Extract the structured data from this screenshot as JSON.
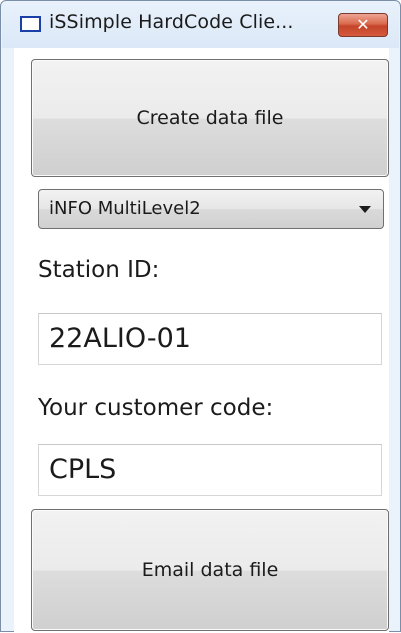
{
  "window": {
    "title": "iSSimple HardCode Clie...",
    "close_label": "✕"
  },
  "buttons": {
    "create_label": "Create data file",
    "email_label": "Email data file"
  },
  "dropdown": {
    "selected": "iNFO MultiLevel2"
  },
  "station": {
    "label": "Station ID:",
    "value": "22ALIO-01"
  },
  "customer": {
    "label": "Your customer code:",
    "value": "CPLS"
  },
  "icons": {
    "app": "window-icon",
    "close": "close-icon",
    "dropdown": "chevron-down-icon"
  },
  "colors": {
    "close_button": "#d65a3d",
    "app_icon_border": "#1a3fa6",
    "window_frame": "#dbe8f7"
  }
}
